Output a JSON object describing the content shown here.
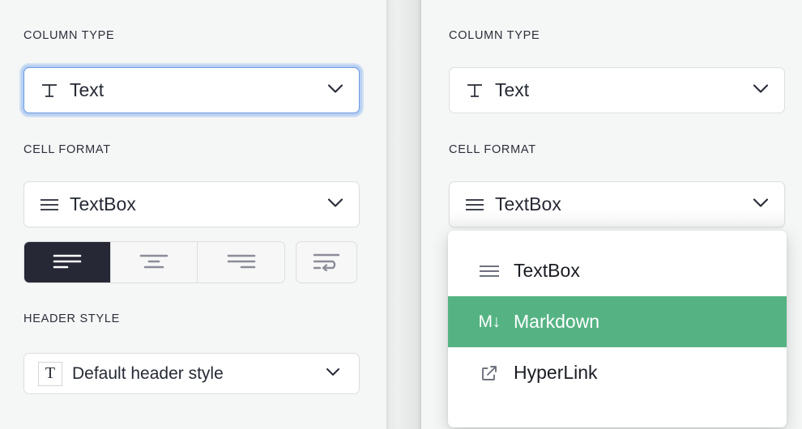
{
  "left_panel": {
    "column_type": {
      "label": "COLUMN TYPE",
      "value": "Text",
      "icon": "text-T-icon",
      "chevron": "chevron-down-icon",
      "focused": true
    },
    "cell_format": {
      "label": "CELL FORMAT",
      "value": "TextBox",
      "icon": "hamburger-lines-icon",
      "chevron": "chevron-down-icon"
    },
    "alignment": {
      "buttons": [
        {
          "name": "align-left",
          "icon": "align-left-icon",
          "active": true
        },
        {
          "name": "align-center",
          "icon": "align-center-icon",
          "active": false
        },
        {
          "name": "align-right",
          "icon": "align-right-icon",
          "active": false
        }
      ],
      "wrap": {
        "name": "wrap-text",
        "icon": "wrap-text-icon",
        "active": false
      }
    },
    "header_style": {
      "label": "HEADER STYLE",
      "value": "Default header style",
      "icon": "boxed-T-icon",
      "icon_glyph": "T",
      "chevron": "chevron-down-icon"
    }
  },
  "right_panel": {
    "column_type": {
      "label": "COLUMN TYPE",
      "value": "Text",
      "icon": "text-T-icon",
      "chevron": "chevron-down-icon"
    },
    "cell_format": {
      "label": "CELL FORMAT",
      "value": "TextBox",
      "icon": "hamburger-lines-icon",
      "chevron": "chevron-down-icon",
      "expanded": true
    },
    "dropdown": {
      "options": [
        {
          "label": "TextBox",
          "icon": "hamburger-lines-icon",
          "highlighted": false
        },
        {
          "label": "Markdown",
          "icon": "markdown-icon",
          "icon_glyph": "M↓",
          "highlighted": true
        },
        {
          "label": "HyperLink",
          "icon": "external-link-icon",
          "highlighted": false
        }
      ]
    }
  },
  "colors": {
    "panel_background": "#f5f6f6",
    "accent_highlight": "#55b383",
    "active_button": "#272836",
    "focus_ring": "#b9d0f2",
    "border": "#dcdee0",
    "text_primary": "#262a35",
    "icon_muted": "#8a8d97"
  }
}
